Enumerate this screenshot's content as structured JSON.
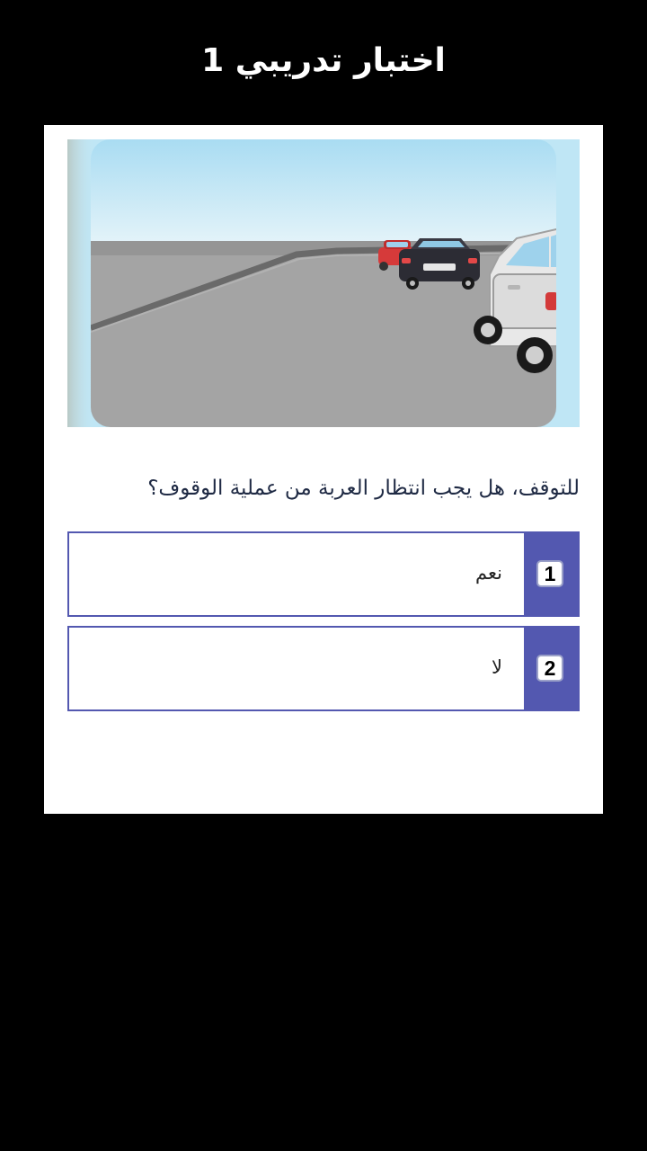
{
  "header": {
    "title": "اختبار تدريبي 1"
  },
  "question": {
    "text": "للتوقف، هل يجب انتظار العربة من عملية الوقوف؟",
    "image_icon": "parking-street-scene"
  },
  "answers": [
    {
      "number": "1",
      "label": "نعم"
    },
    {
      "number": "2",
      "label": "لا"
    }
  ],
  "colors": {
    "background": "#000000",
    "card": "#ffffff",
    "accent": "#5358b0",
    "question_text": "#1f2a44"
  }
}
